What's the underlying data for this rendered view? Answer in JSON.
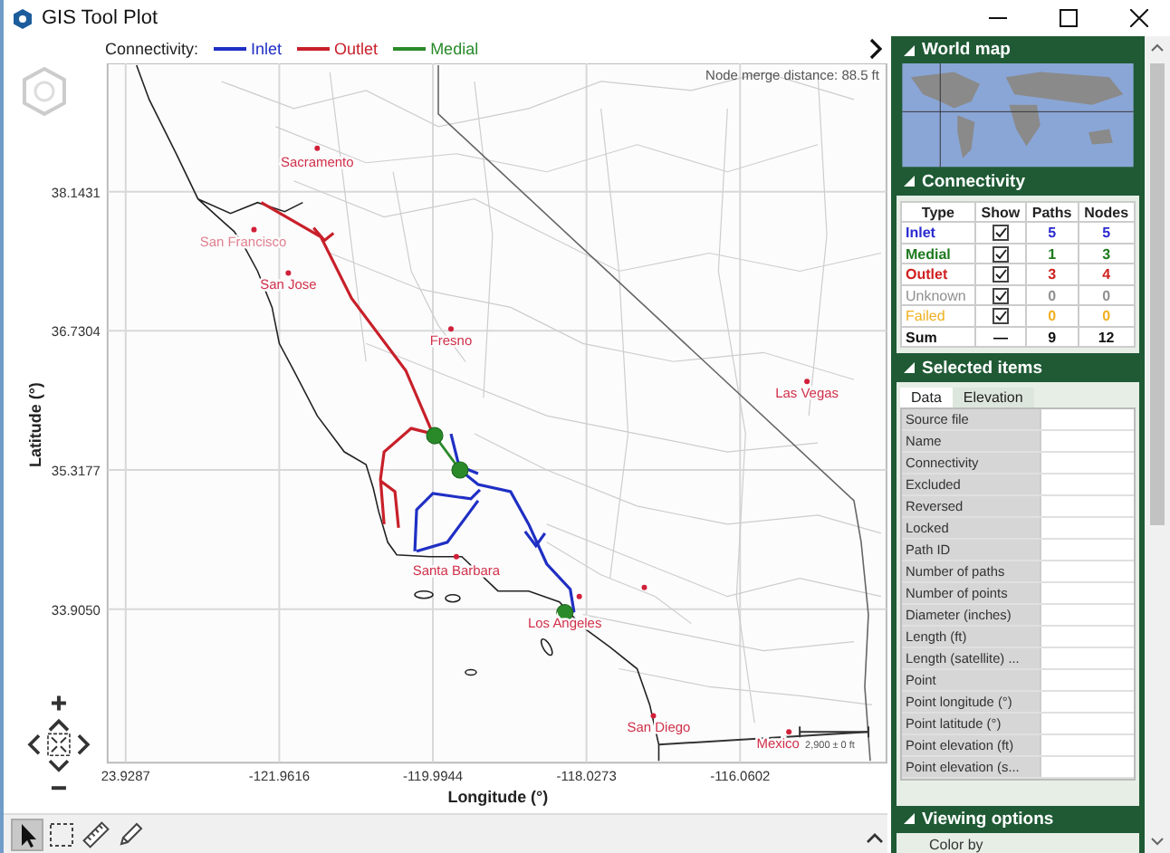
{
  "window": {
    "title": "GIS Tool Plot"
  },
  "legend": {
    "label": "Connectivity:",
    "items": [
      {
        "label": "Inlet",
        "color": "#1f2fc4"
      },
      {
        "label": "Outlet",
        "color": "#c8202a"
      },
      {
        "label": "Medial",
        "color": "#2a8a2a"
      }
    ]
  },
  "map": {
    "node_merge_distance": "Node merge distance: 88.5 ft",
    "places": [
      "Sacramento",
      "San Francisco",
      "San Jose",
      "Fresno",
      "Las Vegas",
      "Santa Barbara",
      "Los Angeles",
      "San Diego",
      "Mexico"
    ],
    "scale_label": "2,900 ± 0 ft",
    "x_ticks": [
      "23.9287",
      "-121.9616",
      "-119.9944",
      "-118.0273",
      "-116.0602"
    ],
    "y_ticks": [
      "38.1431",
      "36.7304",
      "35.3177",
      "33.9050"
    ],
    "xlabel": "Longitude (°)",
    "ylabel": "Latitude (°)"
  },
  "tools": [
    {
      "kind": "pointer",
      "selected": true
    },
    {
      "kind": "box_select",
      "selected": false
    },
    {
      "kind": "ruler",
      "selected": false
    },
    {
      "kind": "pencil",
      "selected": false
    }
  ],
  "sections": [
    {
      "kind": "world_map",
      "title": "World map",
      "expanded": true
    },
    {
      "kind": "connectivity",
      "title": "Connectivity",
      "expanded": true,
      "columns": [
        "Type",
        "Show",
        "Paths",
        "Nodes"
      ],
      "rows": [
        {
          "kind": "type",
          "type": "Inlet",
          "color": "#2a2ad0",
          "checked": true,
          "paths": "5",
          "nodes": "5"
        },
        {
          "kind": "type",
          "type": "Medial",
          "color": "#1e7a1e",
          "checked": true,
          "paths": "1",
          "nodes": "3"
        },
        {
          "kind": "type",
          "type": "Outlet",
          "color": "#d02020",
          "checked": true,
          "paths": "3",
          "nodes": "4"
        },
        {
          "kind": "type",
          "type": "Unknown",
          "color": "#909090",
          "checked": true,
          "paths": "0",
          "nodes": "0"
        },
        {
          "kind": "type",
          "type": "Failed",
          "color": "#f0b020",
          "checked": true,
          "paths": "0",
          "nodes": "0"
        },
        {
          "kind": "sum",
          "type": "Sum",
          "show": "—",
          "paths": "9",
          "nodes": "12"
        }
      ]
    },
    {
      "kind": "selected_items",
      "title": "Selected items",
      "expanded": true,
      "tabs": [
        {
          "label": "Data",
          "selected": true
        },
        {
          "label": "Elevation",
          "selected": false
        }
      ],
      "properties": [
        "Source file",
        "Name",
        "Connectivity",
        "Excluded",
        "Reversed",
        "Locked",
        "Path ID",
        "Number of paths",
        "Number of points",
        "Diameter (inches)",
        "Length (ft)",
        "Length (satellite) ...",
        "Point",
        "Point longitude (°)",
        "Point latitude (°)",
        "Point elevation (ft)",
        "Point elevation (s..."
      ]
    },
    {
      "kind": "viewing_options",
      "title": "Viewing options",
      "expanded": true,
      "items": [
        "Color by"
      ]
    }
  ]
}
